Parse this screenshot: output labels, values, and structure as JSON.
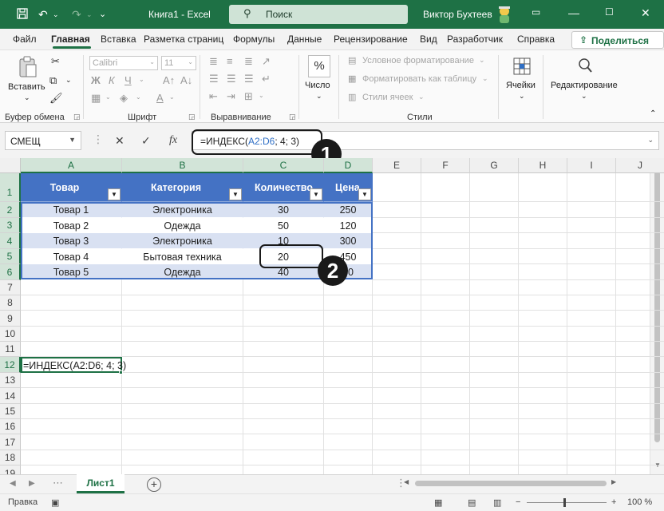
{
  "titlebar": {
    "doc_title": "Книга1  -  Excel",
    "search_placeholder": "Поиск",
    "user_name": "Виктор Бухтеев"
  },
  "menu": {
    "tabs": [
      "Файл",
      "Главная",
      "Вставка",
      "Разметка страниц",
      "Формулы",
      "Данные",
      "Рецензирование",
      "Вид",
      "Разработчик",
      "Справка"
    ],
    "active_tab": "Главная",
    "share_label": "Поделиться"
  },
  "ribbon": {
    "clipboard": {
      "paste_label": "Вставить",
      "group_label": "Буфер обмена"
    },
    "font": {
      "font_name": "Calibri",
      "font_size": "11",
      "group_label": "Шрифт"
    },
    "alignment": {
      "group_label": "Выравнивание"
    },
    "number": {
      "label": "Число",
      "symbol": "%"
    },
    "styles": {
      "conditional": "Условное форматирование",
      "format_table": "Форматировать как таблицу",
      "cell_styles": "Стили ячеек",
      "group_label": "Стили"
    },
    "cells": {
      "label": "Ячейки"
    },
    "editing": {
      "label": "Редактирование"
    }
  },
  "formula_bar": {
    "name_box": "СМЕЩ",
    "formula_prefix": "=ИНДЕКС(",
    "formula_ref": "A2:D6",
    "formula_suffix": "; 4; 3)"
  },
  "callouts": [
    "1",
    "2"
  ],
  "sheet": {
    "columns": [
      "A",
      "B",
      "C",
      "D",
      "E",
      "F",
      "G",
      "H",
      "I",
      "J"
    ],
    "rows": [
      "1",
      "2",
      "3",
      "4",
      "5",
      "6",
      "7",
      "8",
      "9",
      "10",
      "11",
      "12",
      "13",
      "14",
      "15",
      "16",
      "17",
      "18",
      "19"
    ],
    "headers": [
      "Товар",
      "Категория",
      "Количество",
      "Цена"
    ],
    "data": [
      [
        "Товар 1",
        "Электроника",
        "30",
        "250"
      ],
      [
        "Товар 2",
        "Одежда",
        "50",
        "120"
      ],
      [
        "Товар 3",
        "Электроника",
        "10",
        "300"
      ],
      [
        "Товар 4",
        "Бытовая техника",
        "20",
        "450"
      ],
      [
        "Товар 5",
        "Одежда",
        "40",
        "80"
      ]
    ],
    "active_cell_text": "=ИНДЕКС(A2:D6; 4; 3)"
  },
  "sheet_tabs": {
    "active": "Лист1"
  },
  "status": {
    "mode": "Правка",
    "zoom": "100 %"
  },
  "colors": {
    "accent": "#1e7145",
    "table_header": "#4472c4",
    "table_band": "#d9e1f2"
  }
}
